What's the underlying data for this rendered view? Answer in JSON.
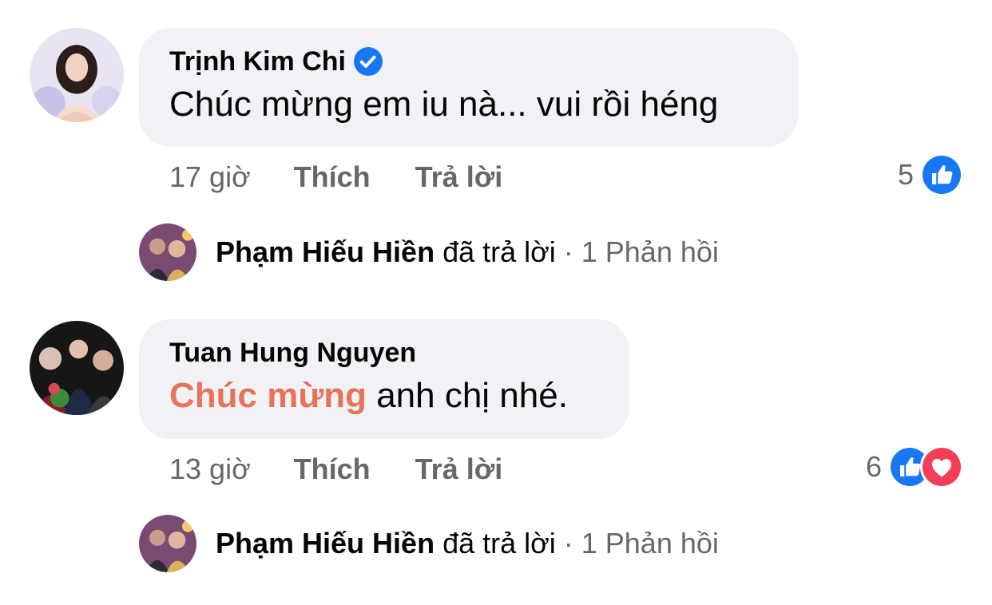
{
  "comments": [
    {
      "author": "Trịnh Kim Chi",
      "verified": true,
      "text_highlight": "",
      "text": "Chúc mừng em iu nà... vui rồi héng",
      "time": "17 giờ",
      "like_label": "Thích",
      "reply_label": "Trả lời",
      "reaction_count": "5",
      "reactions": [
        "like-icon"
      ],
      "reply_summary": {
        "name": "Phạm Hiếu Hiền",
        "action": " đã trả lời",
        "separator": " · ",
        "count": "1 Phản hồi"
      }
    },
    {
      "author": "Tuan Hung Nguyen",
      "verified": false,
      "text_highlight": "Chúc mừng",
      "text": " anh chị nhé.",
      "time": "13 giờ",
      "like_label": "Thích",
      "reply_label": "Trả lời",
      "reaction_count": "6",
      "reactions": [
        "like-icon",
        "love-icon"
      ],
      "reply_summary": {
        "name": "Phạm Hiếu Hiền",
        "action": " đã trả lời",
        "separator": " · ",
        "count": "1 Phản hồi"
      }
    }
  ],
  "colors": {
    "bubble": "#f0f2f5",
    "muted": "#65676b",
    "like_blue": "#1877f2",
    "love_red": "#f33e58",
    "highlight": "#e8735b"
  }
}
